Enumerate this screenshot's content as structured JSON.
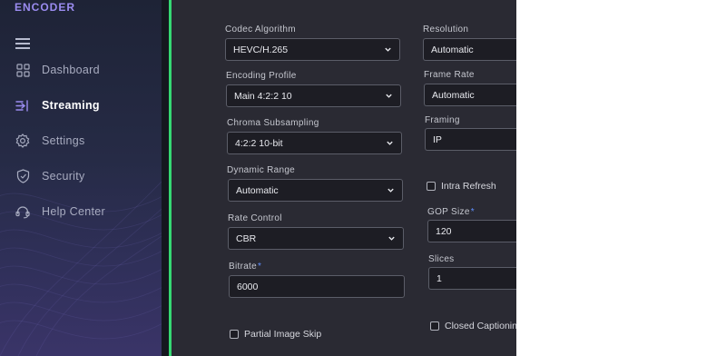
{
  "app": {
    "title": "ENCODER"
  },
  "sidebar": {
    "items": [
      {
        "label": "Dashboard",
        "icon": "dashboard-icon",
        "active": false
      },
      {
        "label": "Streaming",
        "icon": "streaming-icon",
        "active": true
      },
      {
        "label": "Settings",
        "icon": "gear-icon",
        "active": false
      },
      {
        "label": "Security",
        "icon": "shield-icon",
        "active": false
      },
      {
        "label": "Help Center",
        "icon": "headset-icon",
        "active": false
      }
    ]
  },
  "colors": {
    "accent_green": "#35d873",
    "brand_purple": "#9b8cf0",
    "required_marker": "#5f8fff",
    "panel_bg": "#2a2a33"
  },
  "form": {
    "codec_algorithm": {
      "label": "Codec Algorithm",
      "value": "HEVC/H.265"
    },
    "encoding_profile": {
      "label": "Encoding Profile",
      "value": "Main 4:2:2 10"
    },
    "chroma_subsampling": {
      "label": "Chroma Subsampling",
      "value": "4:2:2 10-bit"
    },
    "dynamic_range": {
      "label": "Dynamic Range",
      "value": "Automatic"
    },
    "rate_control": {
      "label": "Rate Control",
      "value": "CBR"
    },
    "bitrate": {
      "label": "Bitrate",
      "required_marker": "*",
      "value": "6000"
    },
    "partial_image_skip": {
      "label": "Partial Image Skip",
      "checked": false
    },
    "resolution": {
      "label": "Resolution",
      "value": "Automatic"
    },
    "frame_rate": {
      "label": "Frame Rate",
      "value": "Automatic"
    },
    "framing": {
      "label": "Framing",
      "value": "IP"
    },
    "intra_refresh": {
      "label": "Intra Refresh",
      "checked": false
    },
    "gop_size": {
      "label": "GOP Size",
      "required_marker": "*",
      "value": "120"
    },
    "slices": {
      "label": "Slices",
      "value": "1"
    },
    "closed_captioning": {
      "label": "Closed Captioning",
      "checked": false
    }
  }
}
